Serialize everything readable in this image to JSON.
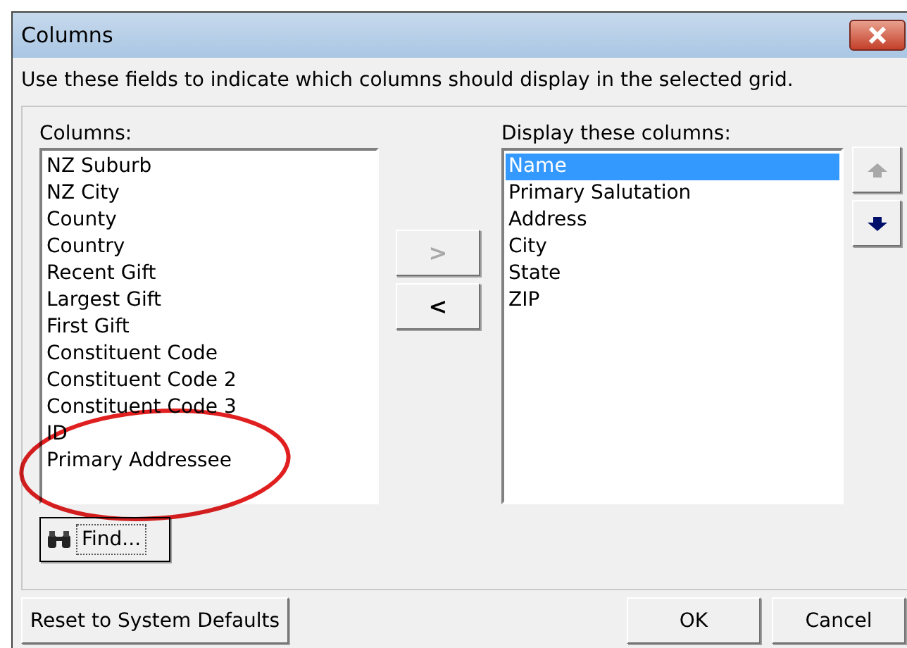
{
  "window": {
    "title": "Columns"
  },
  "instruction": "Use these fields to indicate which columns should display in the selected grid.",
  "available": {
    "label": "Columns:",
    "items": [
      {
        "text": "NZ Suburb",
        "selected": false
      },
      {
        "text": "NZ City",
        "selected": false
      },
      {
        "text": "County",
        "selected": false
      },
      {
        "text": "Country",
        "selected": false
      },
      {
        "text": "Recent Gift",
        "selected": false
      },
      {
        "text": "Largest Gift",
        "selected": false
      },
      {
        "text": "First Gift",
        "selected": false
      },
      {
        "text": "Constituent Code",
        "selected": false
      },
      {
        "text": "Constituent Code 2",
        "selected": false
      },
      {
        "text": "Constituent Code 3",
        "selected": false
      },
      {
        "text": "ID",
        "selected": false
      },
      {
        "text": "Primary Addressee",
        "selected": false
      }
    ]
  },
  "move_buttons": [
    {
      "label": ">",
      "disabled": true
    },
    {
      "label": "<",
      "disabled": false
    }
  ],
  "displayed": {
    "label": "Display these columns:",
    "items": [
      {
        "text": "Name",
        "selected": true
      },
      {
        "text": "Primary Salutation",
        "selected": false
      },
      {
        "text": "Address",
        "selected": false
      },
      {
        "text": "City",
        "selected": false
      },
      {
        "text": "State",
        "selected": false
      },
      {
        "text": "ZIP",
        "selected": false
      }
    ]
  },
  "order_buttons": [
    {
      "kind": "up",
      "disabled": true
    },
    {
      "kind": "down",
      "disabled": false
    }
  ],
  "find_button": "Find...",
  "footer_buttons": [
    "Reset to System Defaults",
    "OK",
    "Cancel"
  ]
}
